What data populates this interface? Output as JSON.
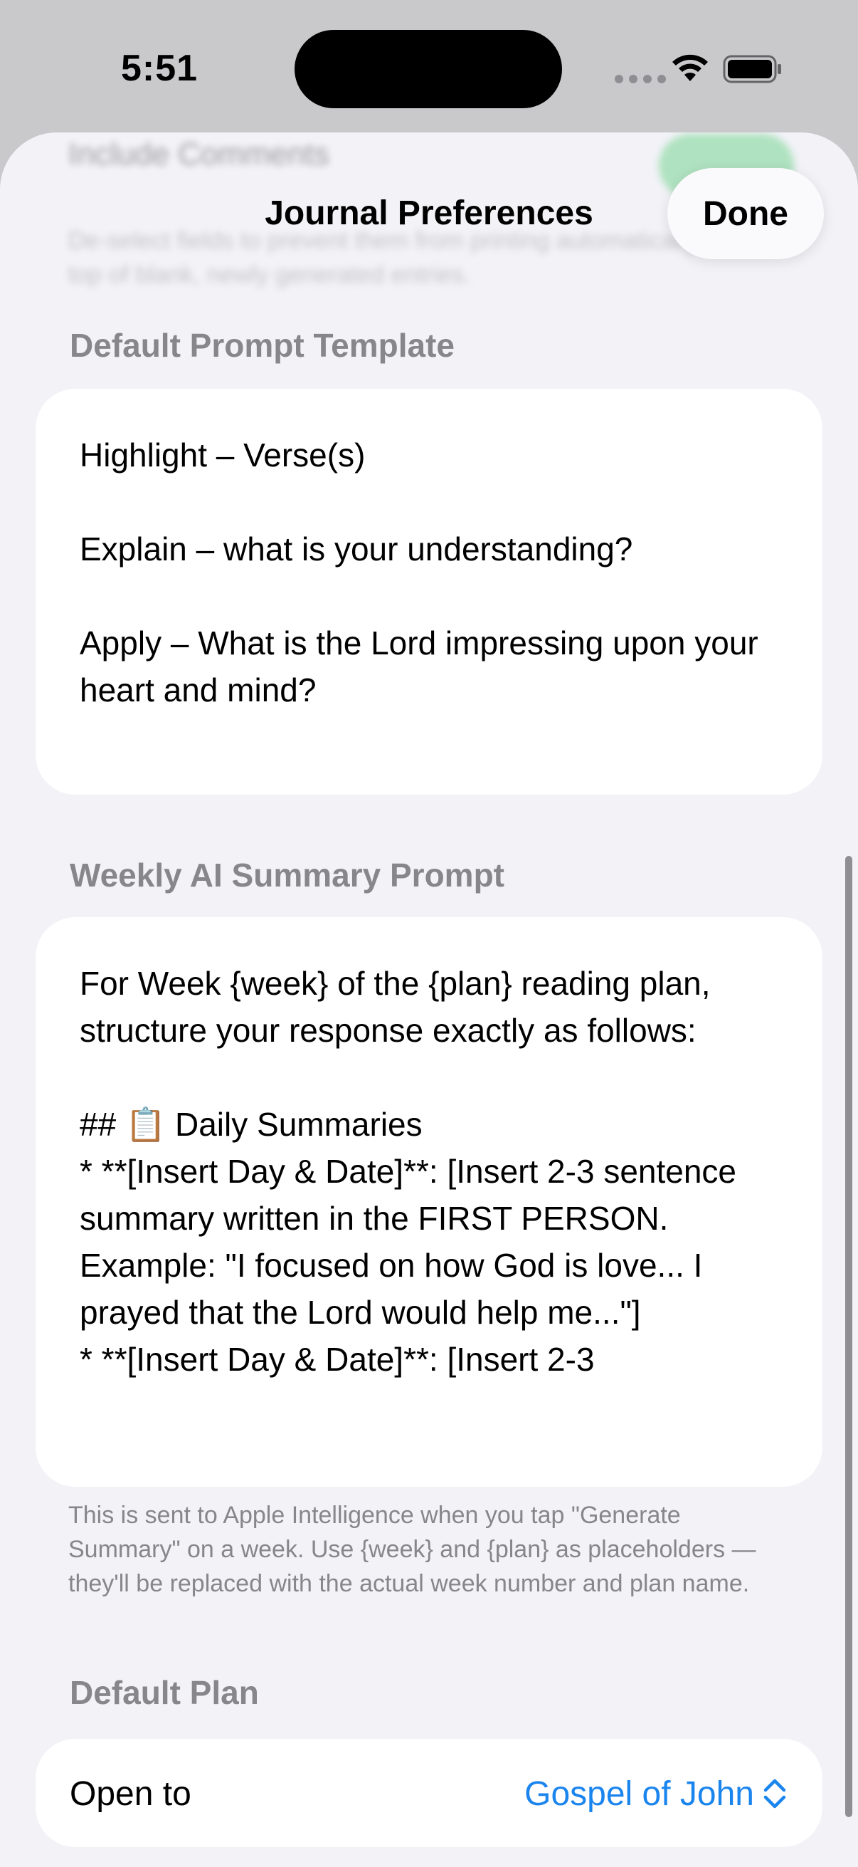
{
  "status_bar": {
    "time": "5:51"
  },
  "hidden_section": {
    "toggle_label": "Include Comments",
    "footnote": "De-select fields to prevent them from printing automatically at the top of blank, newly generated entries."
  },
  "sheet": {
    "title": "Journal Preferences",
    "done_label": "Done"
  },
  "prompt_template": {
    "header": "Default Prompt Template",
    "text": "Highlight – Verse(s)\n\nExplain – what is your understanding?\n\nApply – What is the Lord impressing upon your heart and mind?"
  },
  "weekly_summary": {
    "header": "Weekly AI Summary Prompt",
    "text": "For Week {week} of the {plan} reading plan, structure your response exactly as follows:\n\n## 📋 Daily Summaries\n* **[Insert Day & Date]**: [Insert 2-3 sentence summary written in the FIRST PERSON. Example: \"I focused on how God is love... I prayed that the Lord would help me...\"]\n* **[Insert Day & Date]**: [Insert 2-3",
    "footnote": "This is sent to Apple Intelligence when you tap \"Generate Summary\" on a week. Use {week} and {plan} as placeholders — they'll be replaced with the actual week number and plan name."
  },
  "default_plan": {
    "header": "Default Plan",
    "row_label": "Open to",
    "selected_value": "Gospel of John"
  },
  "colors": {
    "accent": "#1b85ee",
    "toggle_on": "#34c759",
    "sheet_background": "#f2f2f7",
    "secondary_text": "#86868b"
  },
  "icons": [
    "wifi-icon",
    "battery-icon",
    "chevron-updown-icon"
  ]
}
